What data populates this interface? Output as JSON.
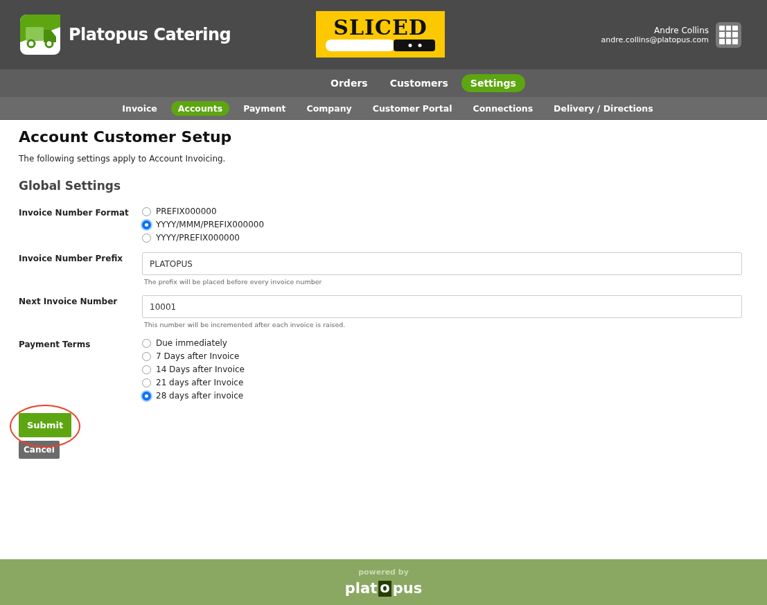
{
  "brand": {
    "name": "Platopus Catering"
  },
  "partner_logo": {
    "text": "SLICED"
  },
  "user": {
    "name": "Andre Collins",
    "email": "andre.collins@platopus.com"
  },
  "main_nav": [
    {
      "label": "Orders",
      "selected": false
    },
    {
      "label": "Customers",
      "selected": false
    },
    {
      "label": "Settings",
      "selected": true
    }
  ],
  "sub_nav": [
    {
      "label": "Invoice",
      "selected": false
    },
    {
      "label": "Accounts",
      "selected": true
    },
    {
      "label": "Payment",
      "selected": false
    },
    {
      "label": "Company",
      "selected": false
    },
    {
      "label": "Customer Portal",
      "selected": false
    },
    {
      "label": "Connections",
      "selected": false
    },
    {
      "label": "Delivery / Directions",
      "selected": false
    }
  ],
  "page": {
    "title": "Account Customer Setup",
    "intro": "The following settings apply to Account Invoicing.",
    "section": "Global Settings"
  },
  "fields": [
    {
      "kind": "radio",
      "label": "Invoice Number Format",
      "options": [
        {
          "label": "PREFIX000000",
          "selected": false
        },
        {
          "label": "YYYY/MMM/PREFIX000000",
          "selected": true
        },
        {
          "label": "YYYY/PREFIX000000",
          "selected": false
        }
      ]
    },
    {
      "kind": "text",
      "label": "Invoice Number Prefix",
      "value": "PLATOPUS",
      "help": "The prefix will be placed before every invoice number"
    },
    {
      "kind": "text",
      "label": "Next Invoice Number",
      "value": "10001",
      "help": "This number will be incremented after each invoice is raised."
    },
    {
      "kind": "radio",
      "label": "Payment Terms",
      "options": [
        {
          "label": "Due immediately",
          "selected": false
        },
        {
          "label": "7 Days after Invoice",
          "selected": false
        },
        {
          "label": "14 Days after Invoice",
          "selected": false
        },
        {
          "label": "21 days after Invoice",
          "selected": false
        },
        {
          "label": "28 days after invoice",
          "selected": true
        }
      ]
    }
  ],
  "buttons": {
    "submit": "Submit",
    "cancel": "Cancel"
  },
  "footer": {
    "powered_by": "powered by",
    "logo_start": "plat",
    "logo_boxed": "o",
    "logo_end": "pus"
  }
}
